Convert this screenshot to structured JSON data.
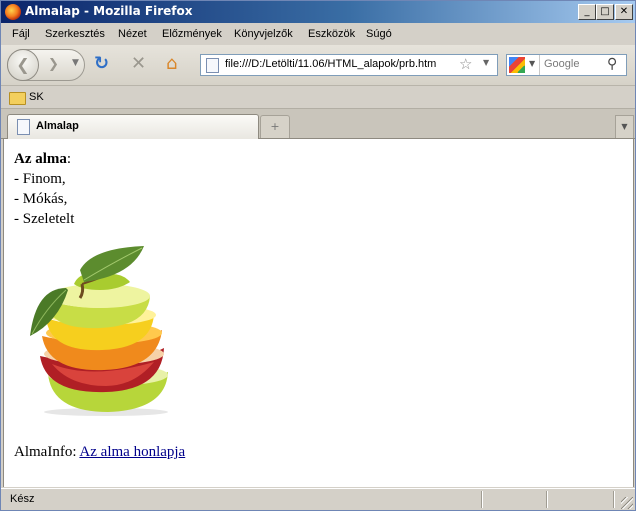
{
  "window": {
    "title": "Almalap - Mozilla Firefox"
  },
  "window_buttons": {
    "minimize": "_",
    "maximize": "□",
    "close": "✕"
  },
  "menu": [
    "Fájl",
    "Szerkesztés",
    "Nézet",
    "Előzmények",
    "Könyvjelzők",
    "Eszközök",
    "Súgó"
  ],
  "navigation": {
    "url": "file:///D:/Letölti/11.06/HTML_alapok/prb.htm",
    "search_placeholder": "Google",
    "icons": [
      "back-icon",
      "forward-icon",
      "reload-icon",
      "stop-icon",
      "home-icon",
      "bookmark-star-icon",
      "search-magnifier-icon"
    ]
  },
  "bookmarks": {
    "items": [
      {
        "label": "SK",
        "icon": "folder-icon"
      }
    ]
  },
  "tabs": [
    {
      "label": "Almalap",
      "active": true
    }
  ],
  "newtab_symbol": "+",
  "page": {
    "heading": "Az alma",
    "heading_suffix": ":",
    "items": [
      "- Finom,",
      "- Mókás,",
      "- Szeletelt"
    ],
    "image": {
      "description": "apple-slices-image"
    },
    "info_label": "AlmaInfo:",
    "link_text": "Az alma honlapja"
  },
  "status": {
    "text": "Kész"
  },
  "colors": {
    "titlebar_start": "#0a246a",
    "titlebar_end": "#a6caf0",
    "link": "#00008b"
  }
}
